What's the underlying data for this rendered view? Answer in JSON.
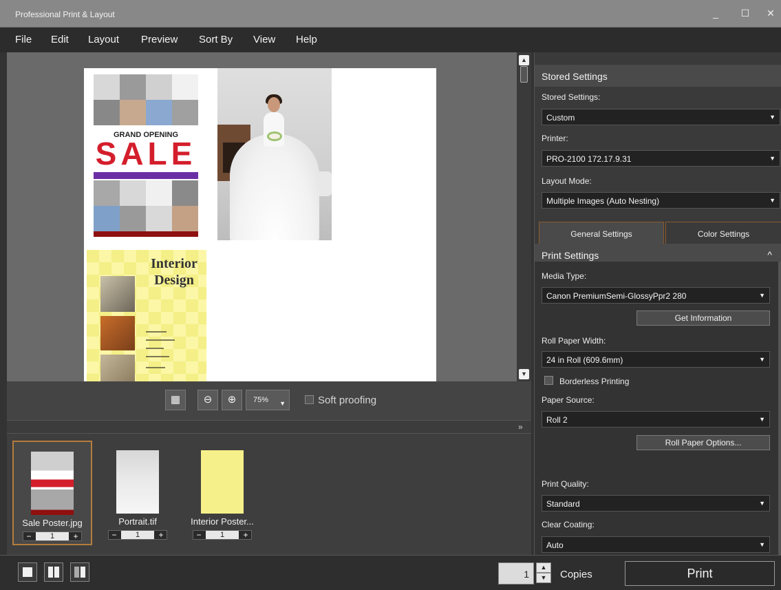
{
  "window": {
    "title": "Professional Print & Layout",
    "minimize": "_",
    "maximize": "☐",
    "close": "✕"
  },
  "menu": [
    "File",
    "Edit",
    "Layout",
    "Preview",
    "Sort By",
    "View",
    "Help"
  ],
  "preview": {
    "sale_poster": {
      "headline": "GRAND OPENING",
      "big": "SALE"
    },
    "interior_poster": {
      "title_line1": "Interior",
      "title_line2": "Design"
    }
  },
  "zoom": {
    "value": "75%",
    "soft_proofing": "Soft proofing"
  },
  "thumbnails": [
    {
      "name": "Sale Poster.jpg",
      "copies": "1"
    },
    {
      "name": "Portrait.tif",
      "copies": "1"
    },
    {
      "name": "Interior Poster...",
      "copies": "1"
    }
  ],
  "panel": {
    "stored_header": "Stored Settings",
    "stored_label": "Stored Settings:",
    "stored_value": "Custom",
    "printer_label": "Printer:",
    "printer_value": "PRO-2100 172.17.9.31",
    "layout_label": "Layout Mode:",
    "layout_value": "Multiple Images (Auto Nesting)",
    "tab_general": "General Settings",
    "tab_color": "Color Settings",
    "print_header": "Print Settings",
    "media_label": "Media Type:",
    "media_value": "Canon PremiumSemi-GlossyPpr2 280",
    "get_info": "Get Information",
    "roll_width_label": "Roll Paper Width:",
    "roll_width_value": "24 in Roll (609.6mm)",
    "borderless": "Borderless Printing",
    "source_label": "Paper Source:",
    "source_value": "Roll 2",
    "roll_options": "Roll Paper Options...",
    "quality_label": "Print Quality:",
    "quality_value": "Standard",
    "coating_label": "Clear Coating:",
    "coating_value": "Auto"
  },
  "bottom": {
    "copies_value": "1",
    "copies_label": "Copies",
    "print": "Print"
  },
  "colors": {
    "accent_border": "#b57c3c",
    "sale_red": "#d41e2c",
    "interior_yellow": "#fbf7a6"
  }
}
